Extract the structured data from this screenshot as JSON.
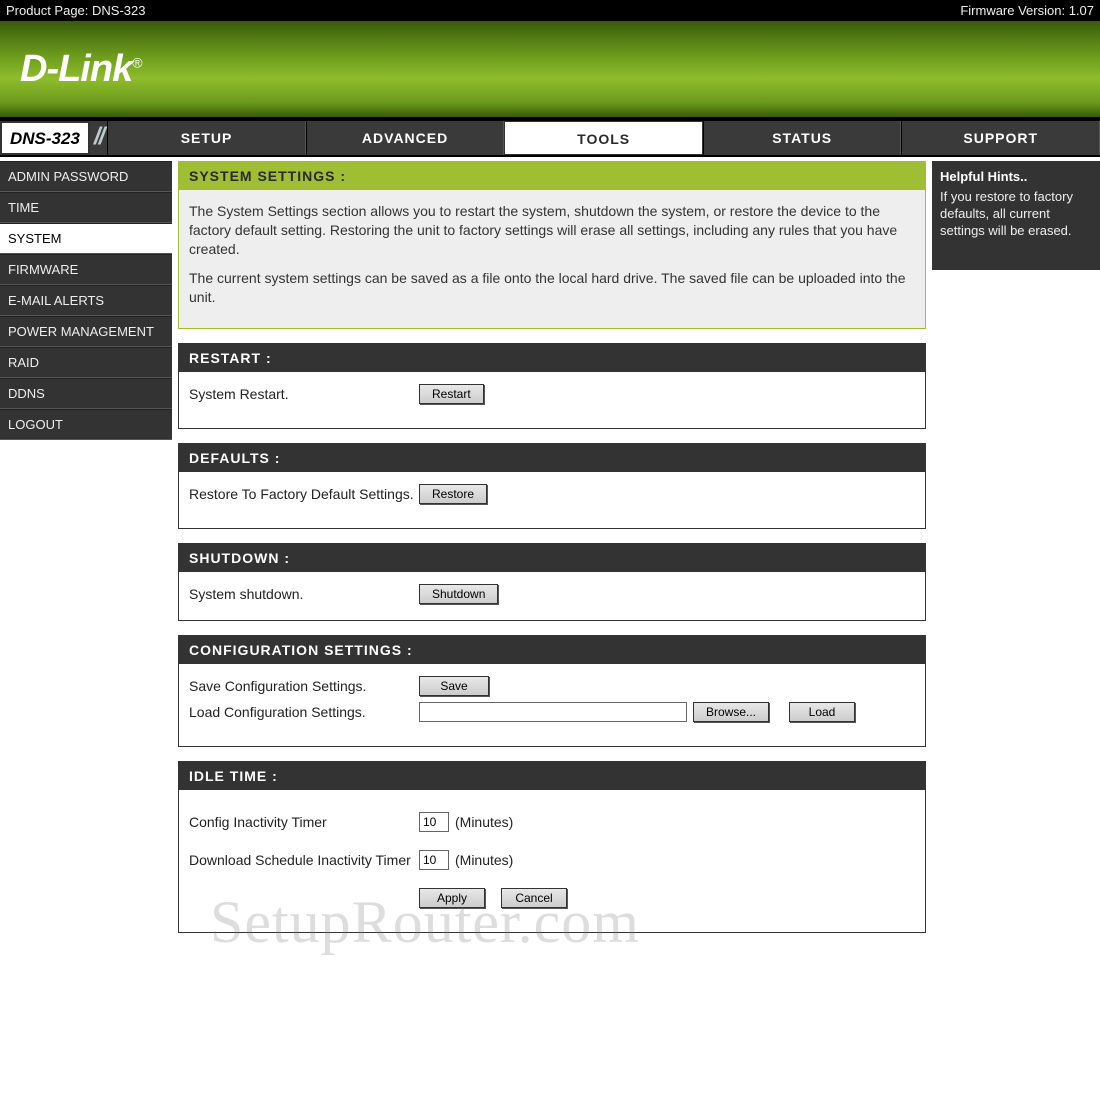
{
  "topbar": {
    "product_page": "Product Page: DNS-323",
    "firmware": "Firmware Version: 1.07"
  },
  "logo": {
    "text": "D-Link",
    "reg": "®"
  },
  "nav": {
    "model": "DNS-323",
    "tabs": [
      "SETUP",
      "ADVANCED",
      "TOOLS",
      "STATUS",
      "SUPPORT"
    ],
    "active": 2
  },
  "sidebar": {
    "items": [
      "ADMIN PASSWORD",
      "TIME",
      "SYSTEM",
      "FIRMWARE",
      "E-MAIL ALERTS",
      "POWER MANAGEMENT",
      "RAID",
      "DDNS",
      "LOGOUT"
    ],
    "active": 2
  },
  "intro": {
    "title": "SYSTEM SETTINGS :",
    "p1": "The System Settings section allows you to restart the system, shutdown the system, or restore the device to the factory default setting. Restoring the unit to factory settings will erase all settings, including any rules that you have created.",
    "p2": "The current system settings can be saved as a file onto the local hard drive. The saved file can be uploaded into the unit."
  },
  "restart": {
    "title": "RESTART :",
    "label": "System Restart.",
    "button": "Restart"
  },
  "defaults": {
    "title": "DEFAULTS :",
    "label": "Restore To Factory Default Settings.",
    "button": "Restore"
  },
  "shutdown": {
    "title": "SHUTDOWN :",
    "label": "System shutdown.",
    "button": "Shutdown"
  },
  "config": {
    "title": "CONFIGURATION SETTINGS :",
    "save_label": "Save Configuration Settings.",
    "save_button": "Save",
    "load_label": "Load Configuration Settings.",
    "file_value": "",
    "browse_button": "Browse...",
    "load_button": "Load"
  },
  "idle": {
    "title": "IDLE TIME :",
    "config_label": "Config Inactivity Timer",
    "config_value": "10",
    "sched_label": "Download Schedule Inactivity Timer",
    "sched_value": "10",
    "unit": "(Minutes)",
    "apply": "Apply",
    "cancel": "Cancel"
  },
  "hints": {
    "title": "Helpful Hints..",
    "text": "If you restore to factory defaults, all current settings will be erased."
  },
  "watermark": "SetupRouter.com"
}
